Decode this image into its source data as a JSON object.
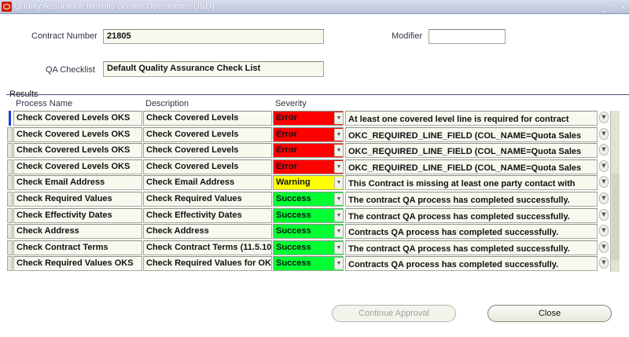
{
  "window": {
    "title": "Quality Assurance Results (Vision Operations, USD)",
    "controls": [
      "_",
      "□",
      "×"
    ]
  },
  "header": {
    "contract_number_label": "Contract Number",
    "contract_number_value": "21805",
    "modifier_label": "Modifier",
    "modifier_value": "",
    "qa_checklist_label": "QA Checklist",
    "qa_checklist_value": "Default Quality Assurance Check List"
  },
  "results": {
    "label": "Results",
    "columns": [
      "Process Name",
      "Description",
      "Severity"
    ],
    "severity_colors": {
      "Error": "#ff0000",
      "Warning": "#ffff00",
      "Success": "#00ff33"
    },
    "rows": [
      {
        "process": "Check Covered Levels OKS",
        "description": "Check Covered Levels",
        "severity": "Error",
        "message": "At least one covered level line is required for contract"
      },
      {
        "process": "Check Covered Levels OKS",
        "description": "Check Covered Levels",
        "severity": "Error",
        "message": "OKC_REQUIRED_LINE_FIELD (COL_NAME=Quota Sales"
      },
      {
        "process": "Check Covered Levels OKS",
        "description": "Check Covered Levels",
        "severity": "Error",
        "message": "OKC_REQUIRED_LINE_FIELD (COL_NAME=Quota Sales"
      },
      {
        "process": "Check Covered Levels OKS",
        "description": "Check Covered Levels",
        "severity": "Error",
        "message": "OKC_REQUIRED_LINE_FIELD (COL_NAME=Quota Sales"
      },
      {
        "process": "Check Email Address",
        "description": "Check Email Address",
        "severity": "Warning",
        "message": "This Contract is missing at least one party contact with"
      },
      {
        "process": "Check Required Values",
        "description": "Check Required Values",
        "severity": "Success",
        "message": "The contract QA process has completed successfully."
      },
      {
        "process": "Check Effectivity Dates",
        "description": "Check Effectivity Dates",
        "severity": "Success",
        "message": "The contract QA process has completed successfully."
      },
      {
        "process": "Check Address",
        "description": "Check Address",
        "severity": "Success",
        "message": "Contracts QA process has completed successfully."
      },
      {
        "process": "Check Contract Terms",
        "description": "Check Contract Terms (11.5.10",
        "severity": "Success",
        "message": "The contract QA process has completed successfully."
      },
      {
        "process": "Check Required Values OKS",
        "description": "Check Required Values for OK",
        "severity": "Success",
        "message": "Contracts QA process has completed successfully."
      }
    ]
  },
  "buttons": {
    "continue_approval": "Continue Approval",
    "close": "Close"
  }
}
